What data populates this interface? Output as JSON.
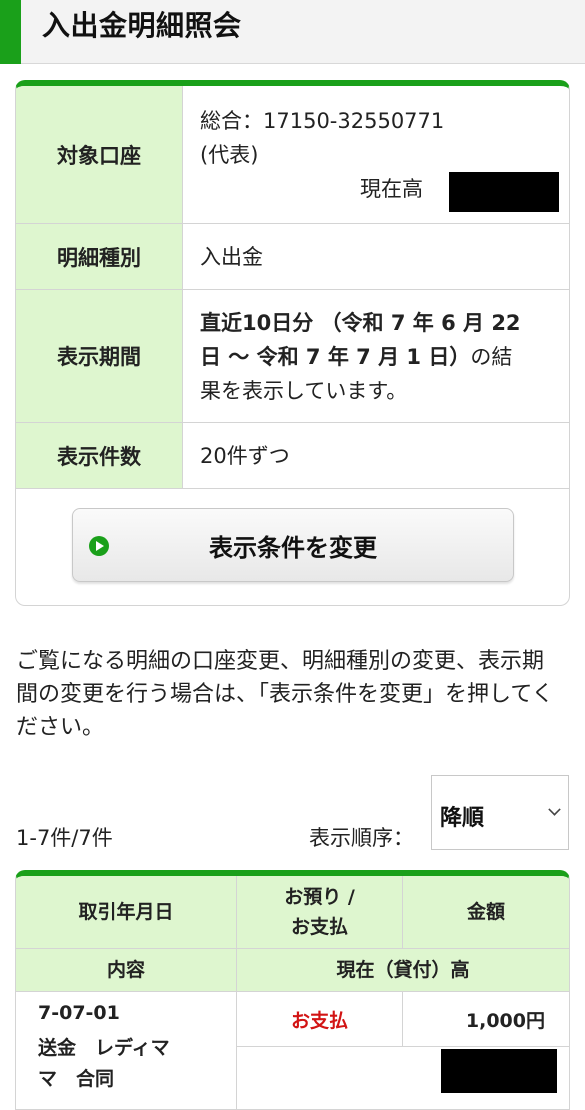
{
  "header": {
    "title": "入出金明細照会"
  },
  "conditions": {
    "account": {
      "label": "対象口座",
      "line1": "総合：17150-32550771",
      "line2": "(代表)",
      "balance_label": "現在高"
    },
    "type": {
      "label": "明細種別",
      "value": "入出金"
    },
    "period": {
      "label": "表示期間",
      "line1": "直近10日分 （令和 7 年 6 月 22",
      "line2_bold": "日 ～ 令和 7 年 7 月 1 日）",
      "line2_normal": "の結",
      "line3": "果を表示しています。"
    },
    "per_page": {
      "label": "表示件数",
      "value": "20件ずつ"
    },
    "change_button": "表示条件を変更"
  },
  "note": "ご覧になる明細の口座変更、明細種別の変更、表示期間の変更を行う場合は、「表示条件を変更」を押してください。",
  "list": {
    "count": "1-7件/7件",
    "order_label": "表示順序：",
    "order_value": "降順"
  },
  "table": {
    "headers": {
      "date": "取引年月日",
      "kind_line1": "お預り /",
      "kind_line2": "お支払",
      "amount": "金額",
      "content": "内容",
      "balance": "現在（貸付）高"
    },
    "rows": [
      {
        "date": "7-07-01",
        "content_line1": "送金　レディマ",
        "content_line2": "マ　合同",
        "kind": "お支払",
        "amount": "1,000円"
      }
    ]
  },
  "colors": {
    "accent": "#1aa01a",
    "label_bg": "#def6cf",
    "payment_red": "#d21414"
  }
}
